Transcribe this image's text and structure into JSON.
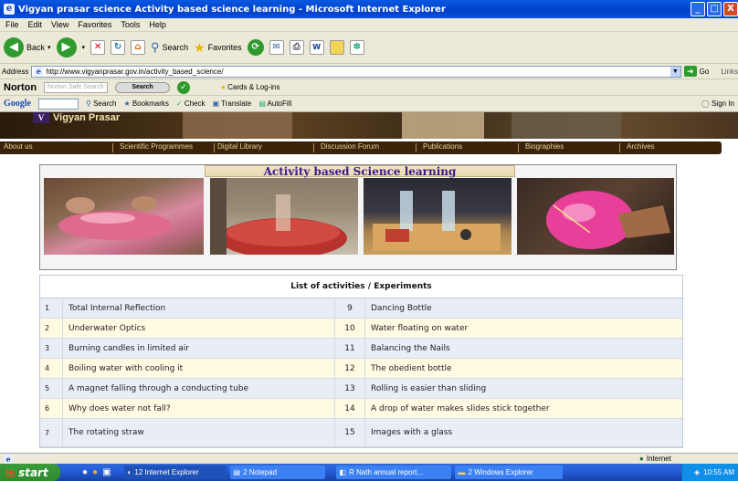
{
  "window": {
    "title": "Vigyan prasar science Activity based science learning - Microsoft Internet Explorer",
    "min": "_",
    "max": "□",
    "close": "X"
  },
  "menu": [
    "File",
    "Edit",
    "View",
    "Favorites",
    "Tools",
    "Help"
  ],
  "toolbar": {
    "back": "Back",
    "search": "Search",
    "favorites": "Favorites"
  },
  "address": {
    "label": "Address",
    "url": "http://www.vigyanprasar.gov.in/activity_based_science/",
    "go": "Go",
    "links": "Links"
  },
  "norton": {
    "brand": "Norton",
    "search_placeholder": "Norton Safe Search",
    "search_button": "Search",
    "cards": "Cards & Log-ins"
  },
  "google": {
    "brand": "Google",
    "search": "Search",
    "bookmarks": "Bookmarks",
    "check": "Check",
    "translate": "Translate",
    "autofill": "AutoFill",
    "signin": "Sign In"
  },
  "site": {
    "brand": "Vigyan Prasar",
    "nav": [
      "About us",
      "Scientific Programmes",
      "Digital Library",
      "Discussion Forum",
      "Publications",
      "Biographies",
      "Archives"
    ],
    "header_title": "Activity based Science learning",
    "table_title": "List of activities / Experiments",
    "rows": [
      {
        "n1": "1",
        "a1": "Total Internal Reflection",
        "n2": "9",
        "a2": "Dancing Bottle"
      },
      {
        "n1": "2",
        "a1": "Underwater Optics",
        "n2": "10",
        "a2": "Water floating on water"
      },
      {
        "n1": "3",
        "a1": "Burning candles in limited air",
        "n2": "11",
        "a2": "Balancing the Nails"
      },
      {
        "n1": "4",
        "a1": "Boiling water with cooling it",
        "n2": "12",
        "a2": "The obedient bottle"
      },
      {
        "n1": "5",
        "a1": "A magnet falling through a conducting tube",
        "n2": "13",
        "a2": "Rolling is easier than sliding"
      },
      {
        "n1": "6",
        "a1": "Why does water not fall?",
        "n2": "14",
        "a2": "A drop of water makes slides stick together"
      },
      {
        "n1": "7",
        "a1": "The rotating straw",
        "n2": "15",
        "a2": "Images with a glass"
      }
    ]
  },
  "status": {
    "zone": "Internet"
  },
  "taskbar": {
    "start": "start",
    "tasks": [
      "12 Internet Explorer",
      "2 Notepad",
      "R Nath annual report...",
      "2 Windows Explorer"
    ],
    "clock": "10:55 AM"
  },
  "colors": {
    "title_blue": "#0a4fd8",
    "nav_brown": "#3a2308",
    "row_blue": "#e8edf6",
    "row_cream": "#fffbe2"
  }
}
